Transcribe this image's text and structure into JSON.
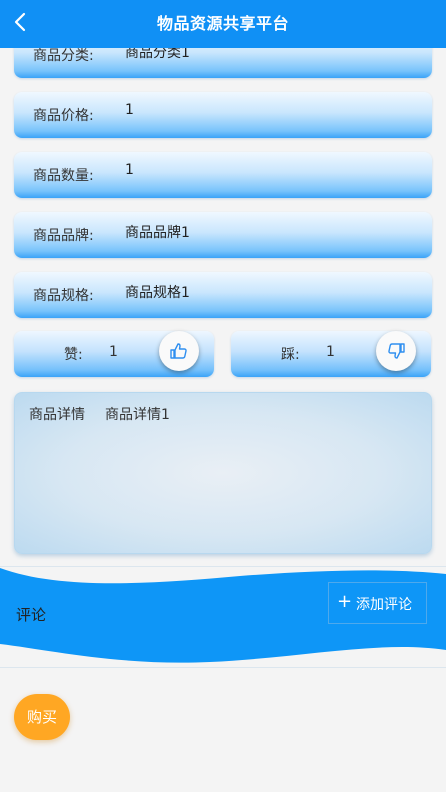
{
  "header": {
    "title": "物品资源共享平台",
    "back_icon": "chevron-left-icon",
    "background": "#1090f5"
  },
  "fields": [
    {
      "label": "商品分类:",
      "value": "商品分类1"
    },
    {
      "label": "商品价格:",
      "value": "1"
    },
    {
      "label": "商品数量:",
      "value": "1"
    },
    {
      "label": "商品品牌:",
      "value": "商品品牌1"
    },
    {
      "label": "商品规格:",
      "value": "商品规格1"
    }
  ],
  "votes": {
    "like": {
      "label": "赞:",
      "count": "1",
      "icon": "thumbs-up-icon"
    },
    "dislike": {
      "label": "踩:",
      "count": "1",
      "icon": "thumbs-down-icon"
    }
  },
  "detail": {
    "label": "商品详情",
    "value": "商品详情1"
  },
  "comments": {
    "label": "评论",
    "add_button": {
      "plus": "+",
      "label": "添加评论"
    },
    "band_color": "#0e96f7"
  },
  "buy_button": {
    "label": "购买",
    "color": "#ffa723"
  }
}
